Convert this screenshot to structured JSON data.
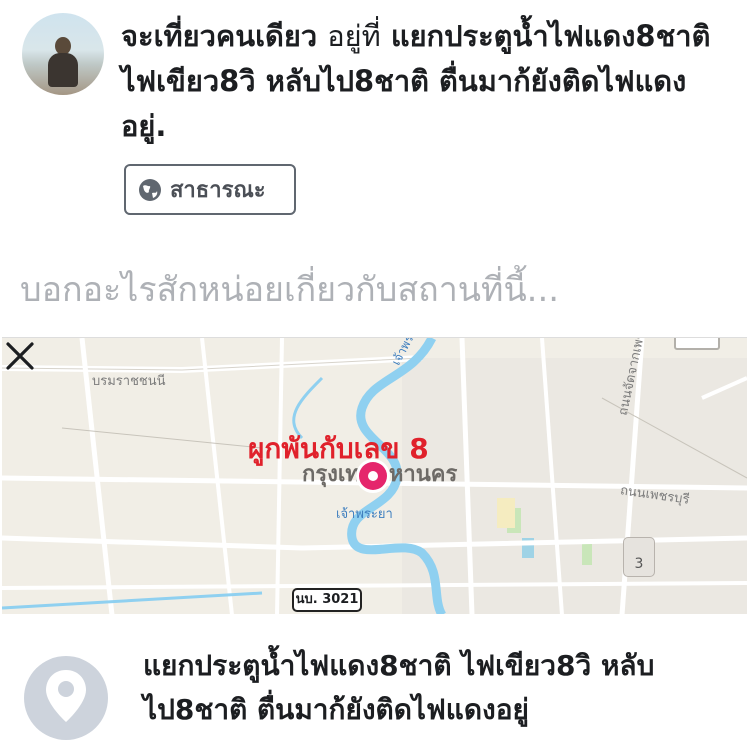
{
  "post": {
    "feeling_text": "จะเที่ยวคนเดียว",
    "at_text": "อยู่ที่",
    "place_text": "แยกประตูน้ำไฟแดง8ชาติ ไฟเขียว8วิ หลับไป8ชาติ ตื่นมาก้ยังติดไฟแดงอยู่.",
    "privacy_label": "สาธารณะ"
  },
  "composer": {
    "placeholder": "บอกอะไรสักหน่อยเกี่ยวกับสถานที่นี้..."
  },
  "map": {
    "caption": "ผูกพันกับเลข 8",
    "city_label": "กรุงเทพมหานคร",
    "river_label": "เจ้าพระยา",
    "river_label_north": "เจ้าพระยา",
    "road_labels": [
      "บรมราชชนนี",
      "ถนนจัดจากเพช",
      "ถนนเพชรบุรี"
    ],
    "road_shield": "นบ. 3021",
    "route_badge": "3",
    "close_icon": "close-icon"
  },
  "place": {
    "name": "แยกประตูน้ำไฟแดง8ชาติ ไฟเขียว8วิ หลับไป8ชาติ ตื่นมาก้ยังติดไฟแดงอยู่"
  },
  "colors": {
    "pin": "#e5266c",
    "caption": "#e0212b",
    "river": "#8fd0f0",
    "placeholder": "#aeb1b6"
  }
}
